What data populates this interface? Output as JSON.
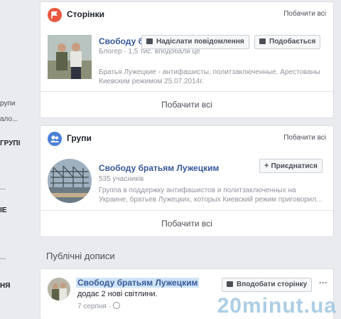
{
  "left_sidebar": {
    "items": [
      {
        "label": "рупи",
        "bold": false
      },
      {
        "label": "ало...",
        "bold": false
      },
      {
        "label": "ГРУПІ",
        "bold": true
      },
      {
        "label": "...",
        "bold": false
      },
      {
        "label": "ІЕ",
        "bold": true
      },
      {
        "label": "...",
        "bold": false
      },
      {
        "label": "НЯ",
        "bold": true
      }
    ]
  },
  "pages_card": {
    "title": "Сторінки",
    "see_all_link": "Побачити всі",
    "page": {
      "name": "Свободу братья...",
      "category": "Блогер",
      "likes": "1,5 тис. вподобали це",
      "description": "Братья Лужецкие - антифашисты, политзаключенные. Арестованы Киевским режимом 25.07.2014г.",
      "message_button": "Надіслати повідомлення",
      "like_button": "Подобається"
    },
    "footer_link": "Побачити всі"
  },
  "groups_card": {
    "title": "Групи",
    "see_all_link": "Побачити всі",
    "group": {
      "name": "Свободу братьям Лужецким",
      "members": "535 учасників",
      "description": "Группа в поддержку антифашистов и политзаключенных на Украине, братьев Лужецких, которых Киевский режим приговорил...",
      "join_button": "Приєднатися"
    },
    "footer_link": "Побачити всі"
  },
  "public_posts": {
    "section_title": "Публічні дописи",
    "post": {
      "author": "Свободу братьям Лужецким",
      "action": "додає 2 нові світлини.",
      "date": "7 серпня",
      "separator": "·",
      "like_page_button": "Вподобати сторінку",
      "more_menu": "···"
    }
  },
  "watermark": "20minut.ua",
  "colors": {
    "background": "#e9ebee",
    "link_blue": "#365899",
    "pages_icon": "#e9573f",
    "groups_icon": "#4a7fd6",
    "highlight": "#cfe3f7"
  },
  "icons": {
    "pages": "flag-icon",
    "groups": "people-icon",
    "message": "messenger-icon",
    "like": "thumbs-up-icon",
    "join": "plus-icon",
    "globe": "globe-icon"
  }
}
